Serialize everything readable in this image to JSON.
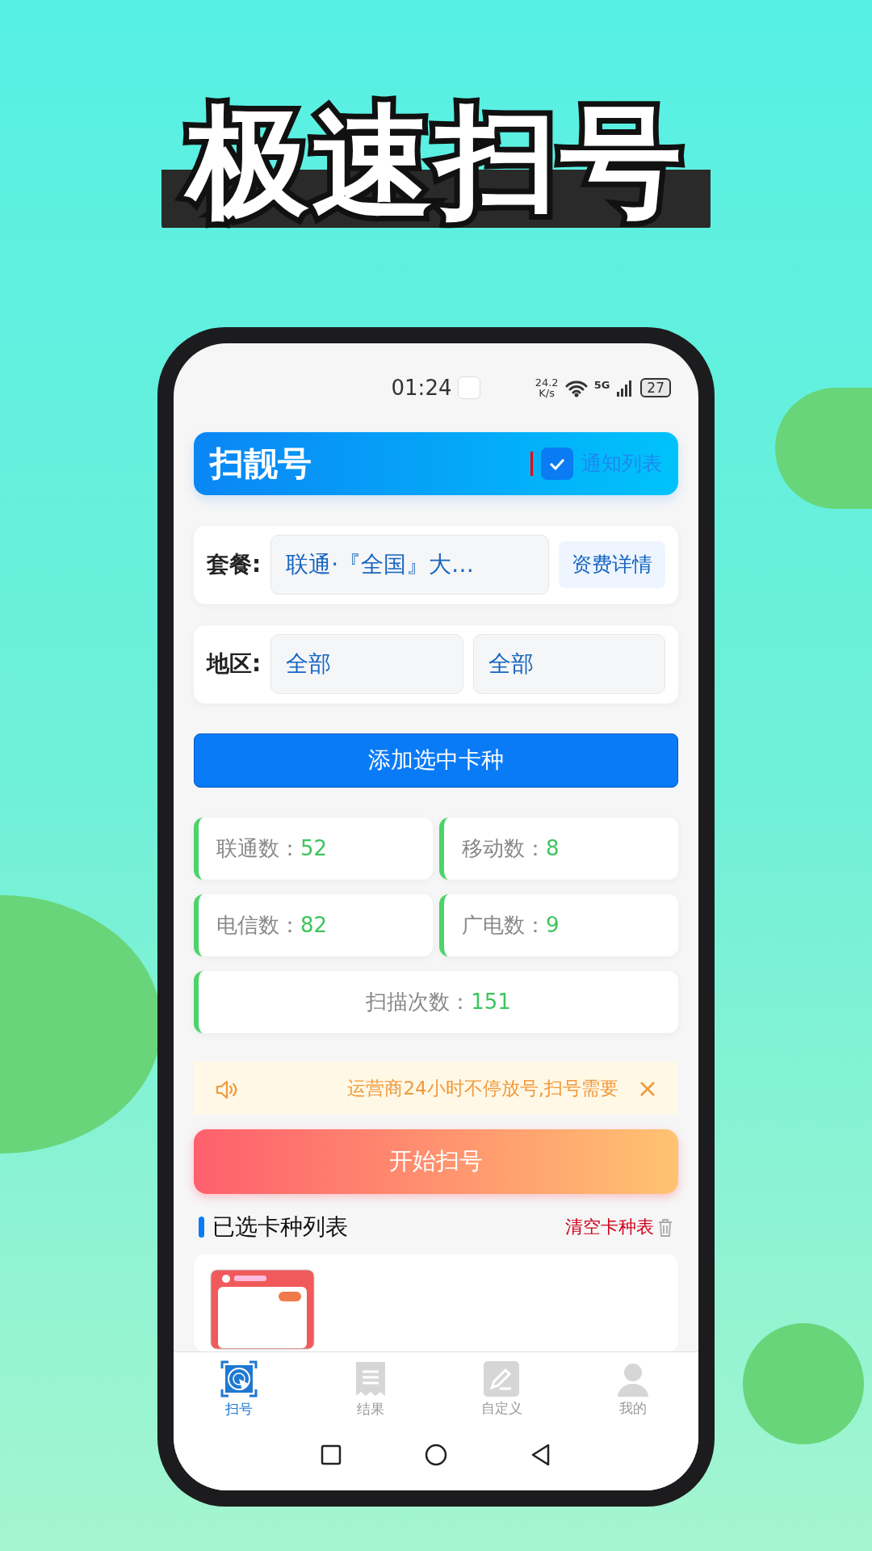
{
  "headline": "极速扫号",
  "status_bar": {
    "time": "01:24",
    "net_speed": "24.2",
    "net_unit": "K/s",
    "network": "5G",
    "battery": "27"
  },
  "header": {
    "title": "扫靓号",
    "notify": {
      "label": "通知列表",
      "checked": true
    }
  },
  "plan": {
    "label": "套餐:",
    "value": "联通·『全国』大…",
    "button": "资费详情"
  },
  "region": {
    "label": "地区:",
    "province": "全部",
    "city": "全部"
  },
  "add_button": "添加选中卡种",
  "stats": [
    {
      "label": "联通数：",
      "value": "52"
    },
    {
      "label": "移动数：",
      "value": "8"
    },
    {
      "label": "电信数：",
      "value": "82"
    },
    {
      "label": "广电数：",
      "value": "9"
    },
    {
      "label": "扫描次数：",
      "value": "151"
    }
  ],
  "notice": {
    "text": "运营商24小时不停放号,扫号需要"
  },
  "start_button": "开始扫号",
  "list": {
    "title": "已选卡种列表",
    "clear": "清空卡种表"
  },
  "tabs": [
    {
      "label": "扫号",
      "selected": true
    },
    {
      "label": "结果",
      "selected": false
    },
    {
      "label": "自定义",
      "selected": false
    },
    {
      "label": "我的",
      "selected": false
    }
  ]
}
